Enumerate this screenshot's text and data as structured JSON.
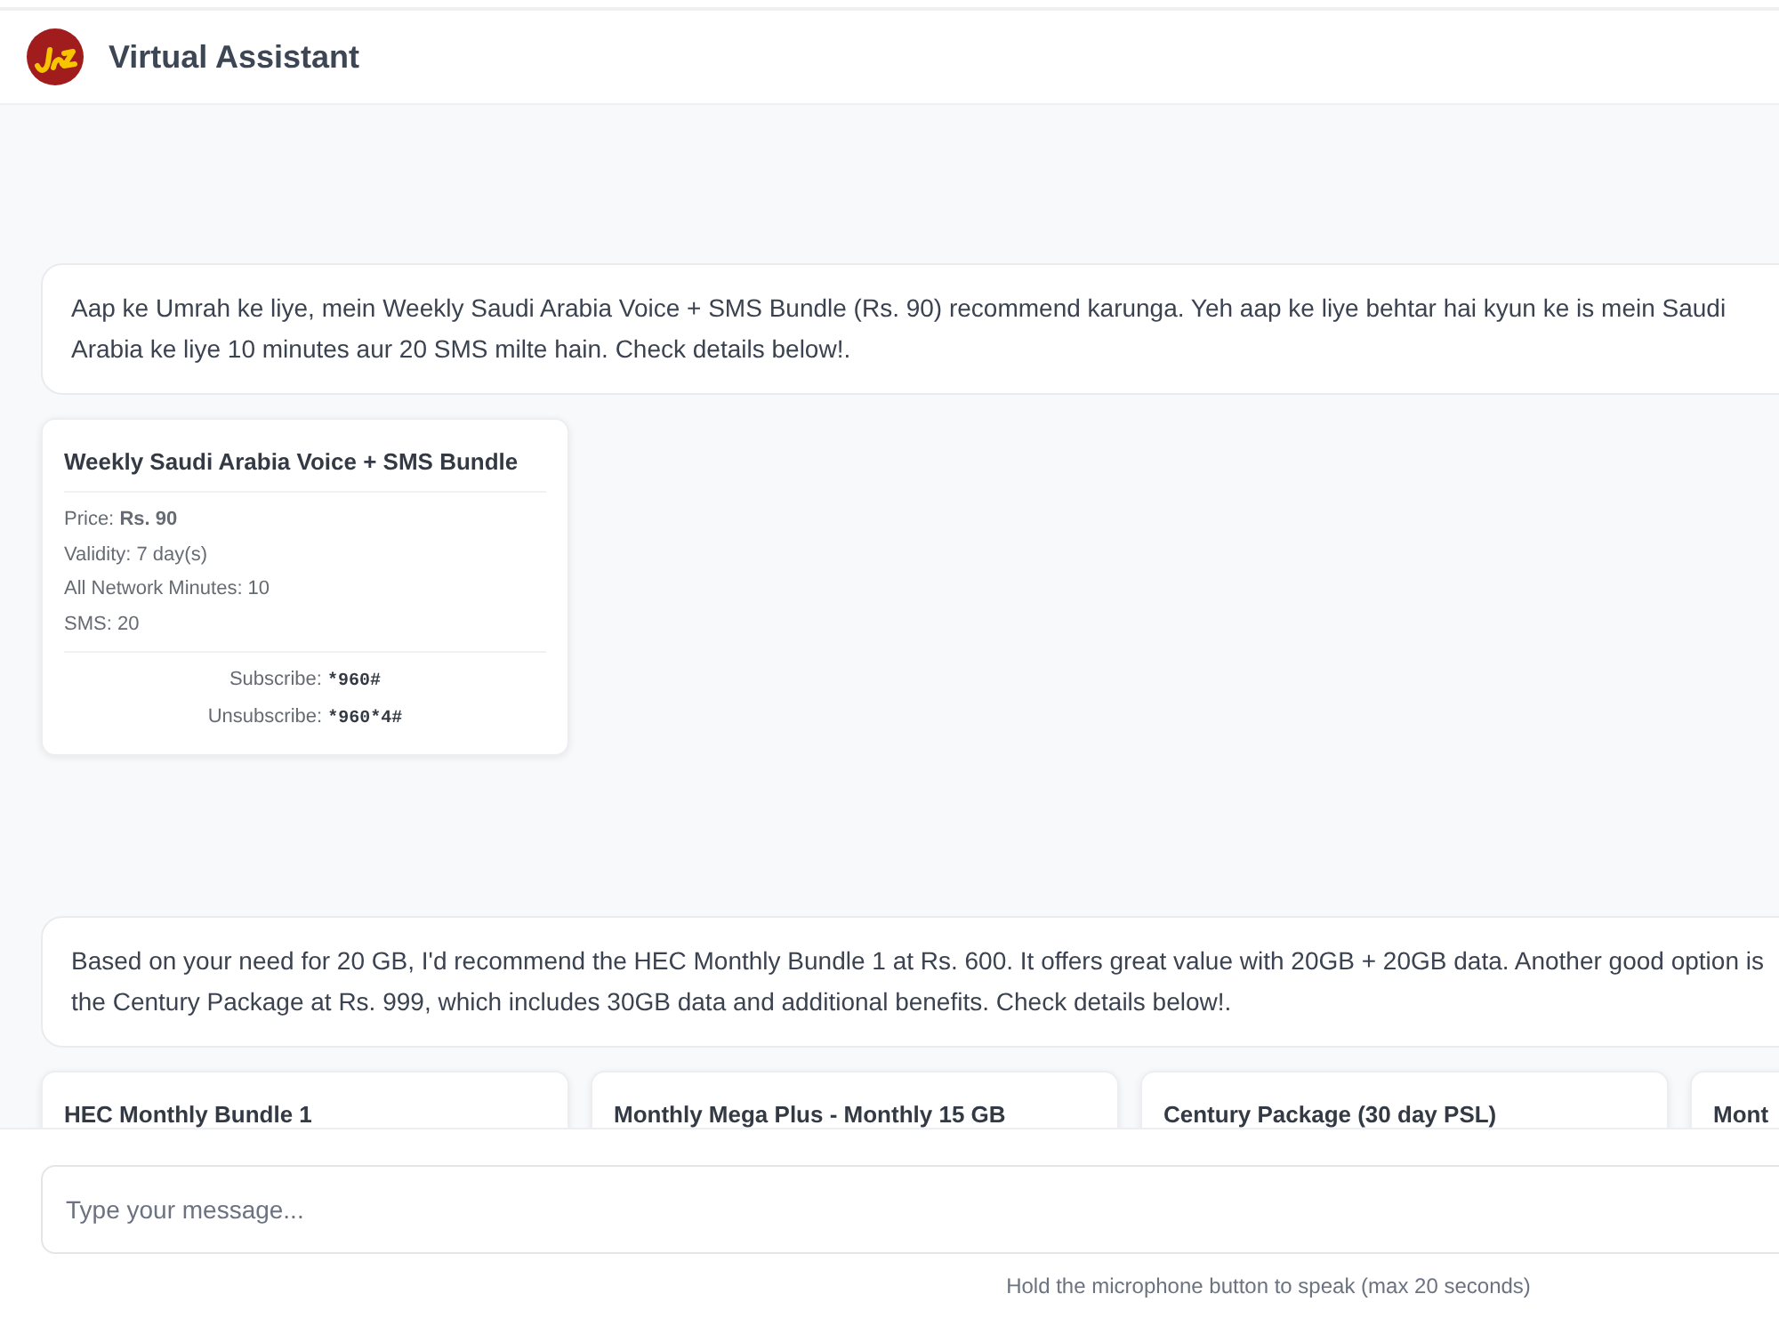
{
  "header": {
    "title": "Virtual Assistant"
  },
  "conversation": [
    {
      "reply": "Aap ke Umrah ke liye, mein Weekly Saudi Arabia Voice + SMS Bundle (Rs. 90) recommend karunga. Yeh aap ke liye behtar hai kyun ke is mein Saudi Arabia ke liye 10 minutes aur 20 SMS milte hain. Check details below!.",
      "bundles": [
        {
          "title": "Weekly Saudi Arabia Voice + SMS Bundle",
          "details": [
            "Price: **Rs. 90**",
            "Validity: 7 day(s)",
            "All Network Minutes: 10",
            "SMS: 20"
          ],
          "codes": [
            {
              "label": "Subscribe:",
              "code": "*960#"
            },
            {
              "label": "Unsubscribe:",
              "code": "*960*4#"
            }
          ]
        }
      ]
    },
    {
      "reply": "Based on your need for 20 GB, I'd recommend the HEC Monthly Bundle 1 at Rs. 600. It offers great value with 20GB + 20GB data. Another good option is the Century Package at Rs. 999, which includes 30GB data and additional benefits. Check details below!.",
      "bundles": [
        {
          "title": "HEC Monthly Bundle 1"
        },
        {
          "title": "Monthly Mega Plus - Monthly 15 GB"
        },
        {
          "title": "Century Package (30 day PSL)"
        },
        {
          "title": "Mont"
        }
      ]
    }
  ],
  "composer": {
    "placeholder": "Type your message...",
    "hint": "Hold the microphone button to speak (max 20 seconds)"
  }
}
